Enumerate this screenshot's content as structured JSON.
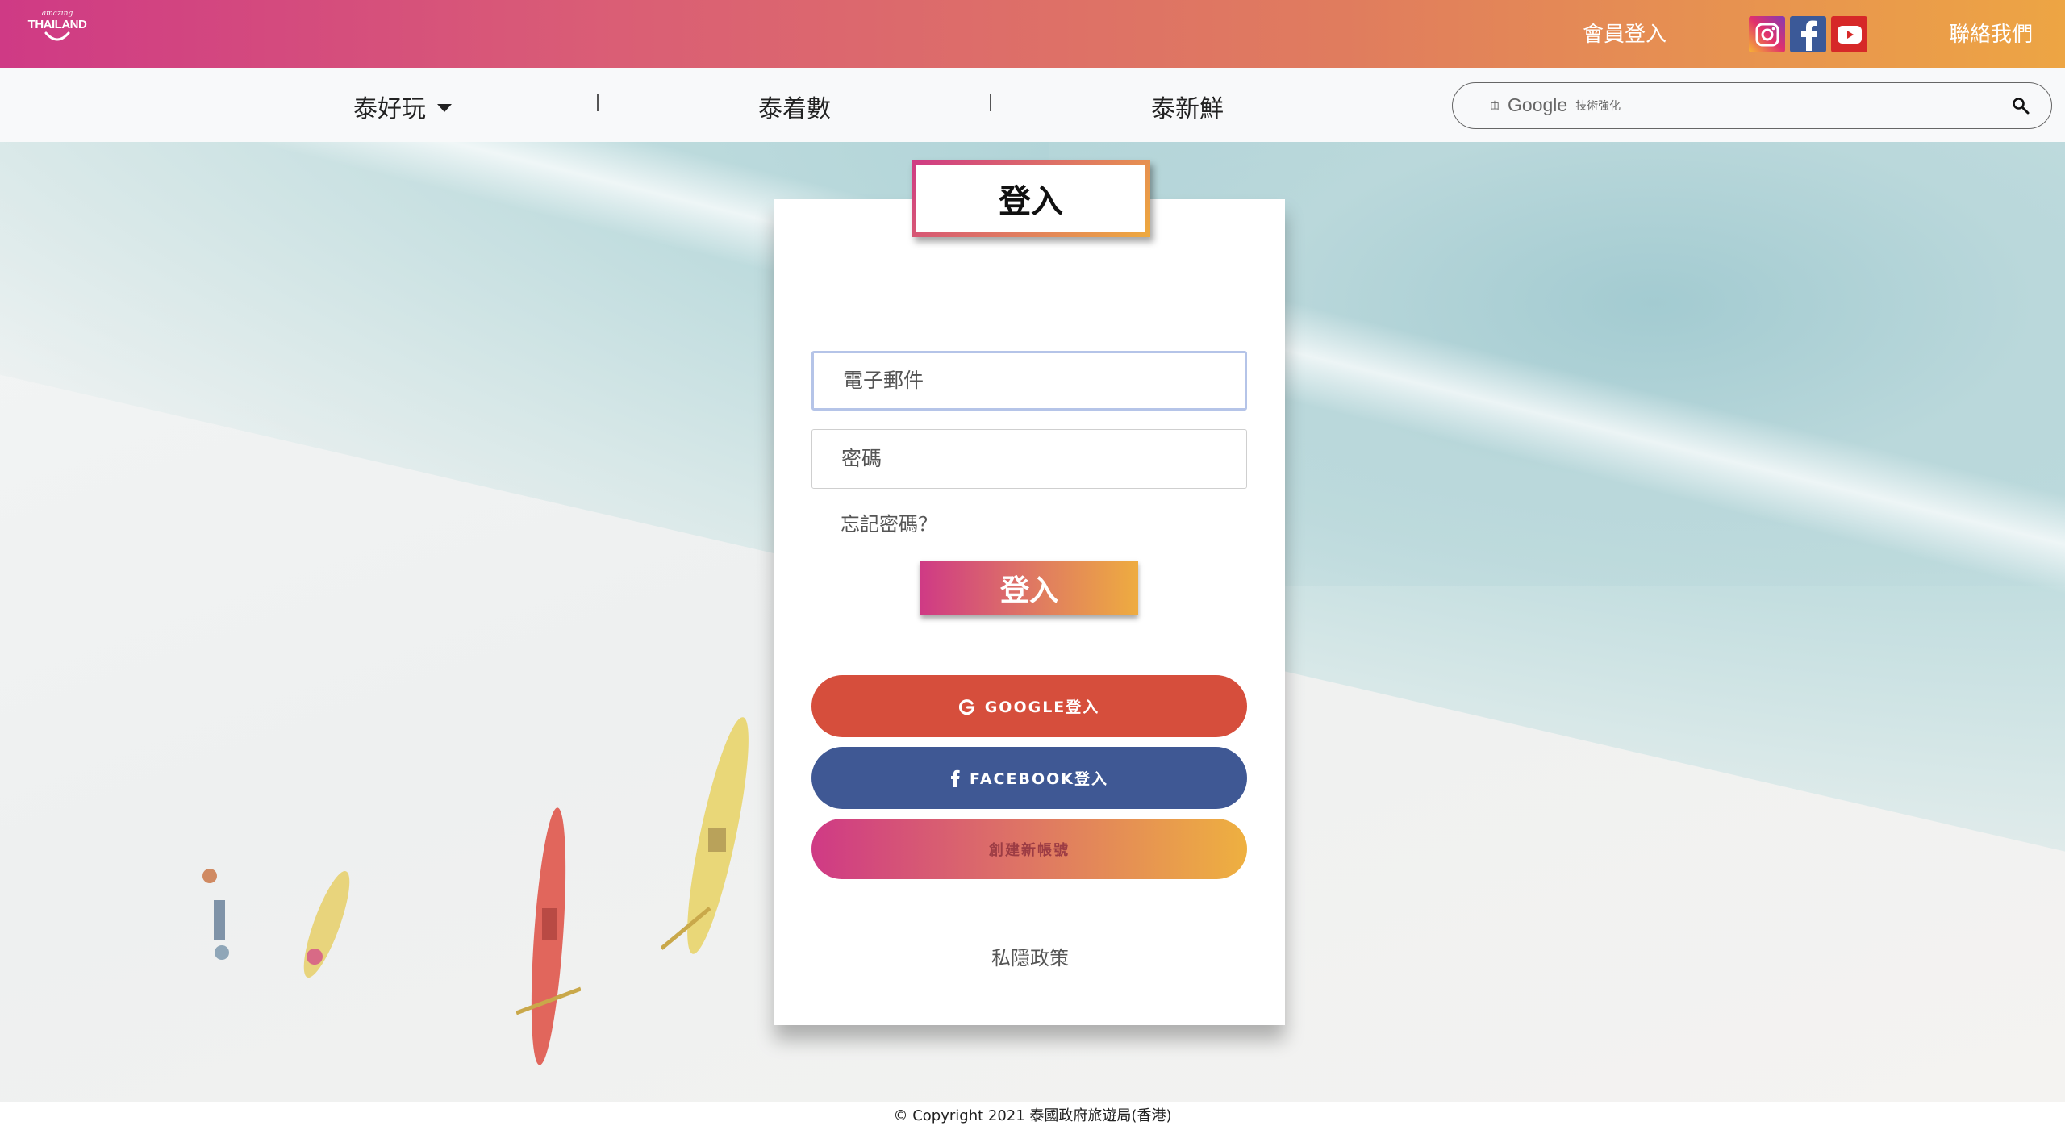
{
  "brand": {
    "logo_small": "amazing",
    "logo_big": "THAILAND"
  },
  "topbar": {
    "member_login": "會員登入",
    "contact": "聯絡我們",
    "social": [
      "instagram-icon",
      "facebook-icon",
      "youtube-icon"
    ],
    "gradient_colors": [
      "#cf3a85",
      "#eda544"
    ]
  },
  "nav": {
    "items": [
      {
        "label": "泰好玩",
        "has_dropdown": true
      },
      {
        "label": "泰着數"
      },
      {
        "label": "泰新鮮"
      }
    ],
    "search": {
      "prefix": "由",
      "brand": "Google",
      "suffix": "技術強化"
    }
  },
  "login": {
    "title": "登入",
    "email_placeholder": "電子郵件",
    "password_placeholder": "密碼",
    "forgot": "忘記密碼？",
    "submit": "登入",
    "google": "GOOGLE登入",
    "facebook": "FACEBOOK登入",
    "create": "創建新帳號",
    "privacy": "私隱政策"
  },
  "footer": {
    "copyright": "© Copyright 2021 泰國政府旅遊局(香港)"
  }
}
